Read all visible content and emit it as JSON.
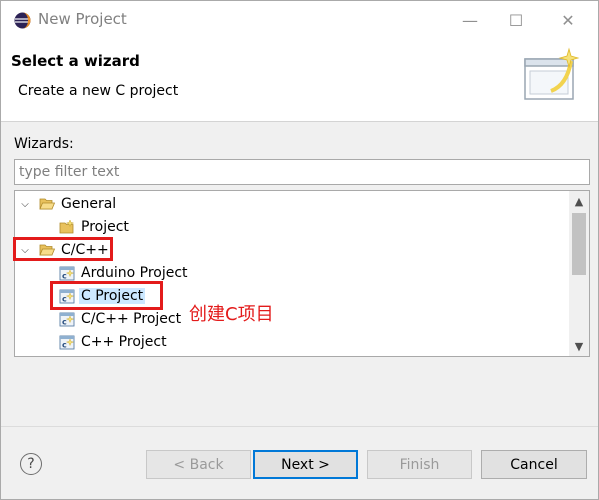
{
  "window": {
    "title": "New Project",
    "minimize_glyph": "—",
    "maximize_glyph": "☐",
    "close_glyph": "✕"
  },
  "header": {
    "title": "Select a wizard",
    "subtitle": "Create a new C project"
  },
  "wizards": {
    "label": "Wizards:",
    "filter_placeholder": "type filter text",
    "filter_value": ""
  },
  "tree": {
    "items": [
      {
        "label": "General",
        "icon": "folder-open-icon",
        "expanded": true
      },
      {
        "label": "Project",
        "icon": "project-icon"
      },
      {
        "label": "C/C++",
        "icon": "folder-open-icon",
        "expanded": true
      },
      {
        "label": "Arduino Project",
        "icon": "c-project-icon"
      },
      {
        "label": "C Project",
        "icon": "c-project-icon",
        "selected": true
      },
      {
        "label": "C/C++ Project",
        "icon": "c-project-icon"
      },
      {
        "label": "C++ Project",
        "icon": "c-project-icon"
      }
    ]
  },
  "annotation": {
    "text": "创建C项目",
    "color": "#e31b1b"
  },
  "buttons": {
    "help": "?",
    "back": "< Back",
    "next": "Next >",
    "finish": "Finish",
    "cancel": "Cancel"
  },
  "colors": {
    "accent": "#0078d7",
    "selection": "#cce8ff",
    "highlight_box": "#e31b1b"
  }
}
